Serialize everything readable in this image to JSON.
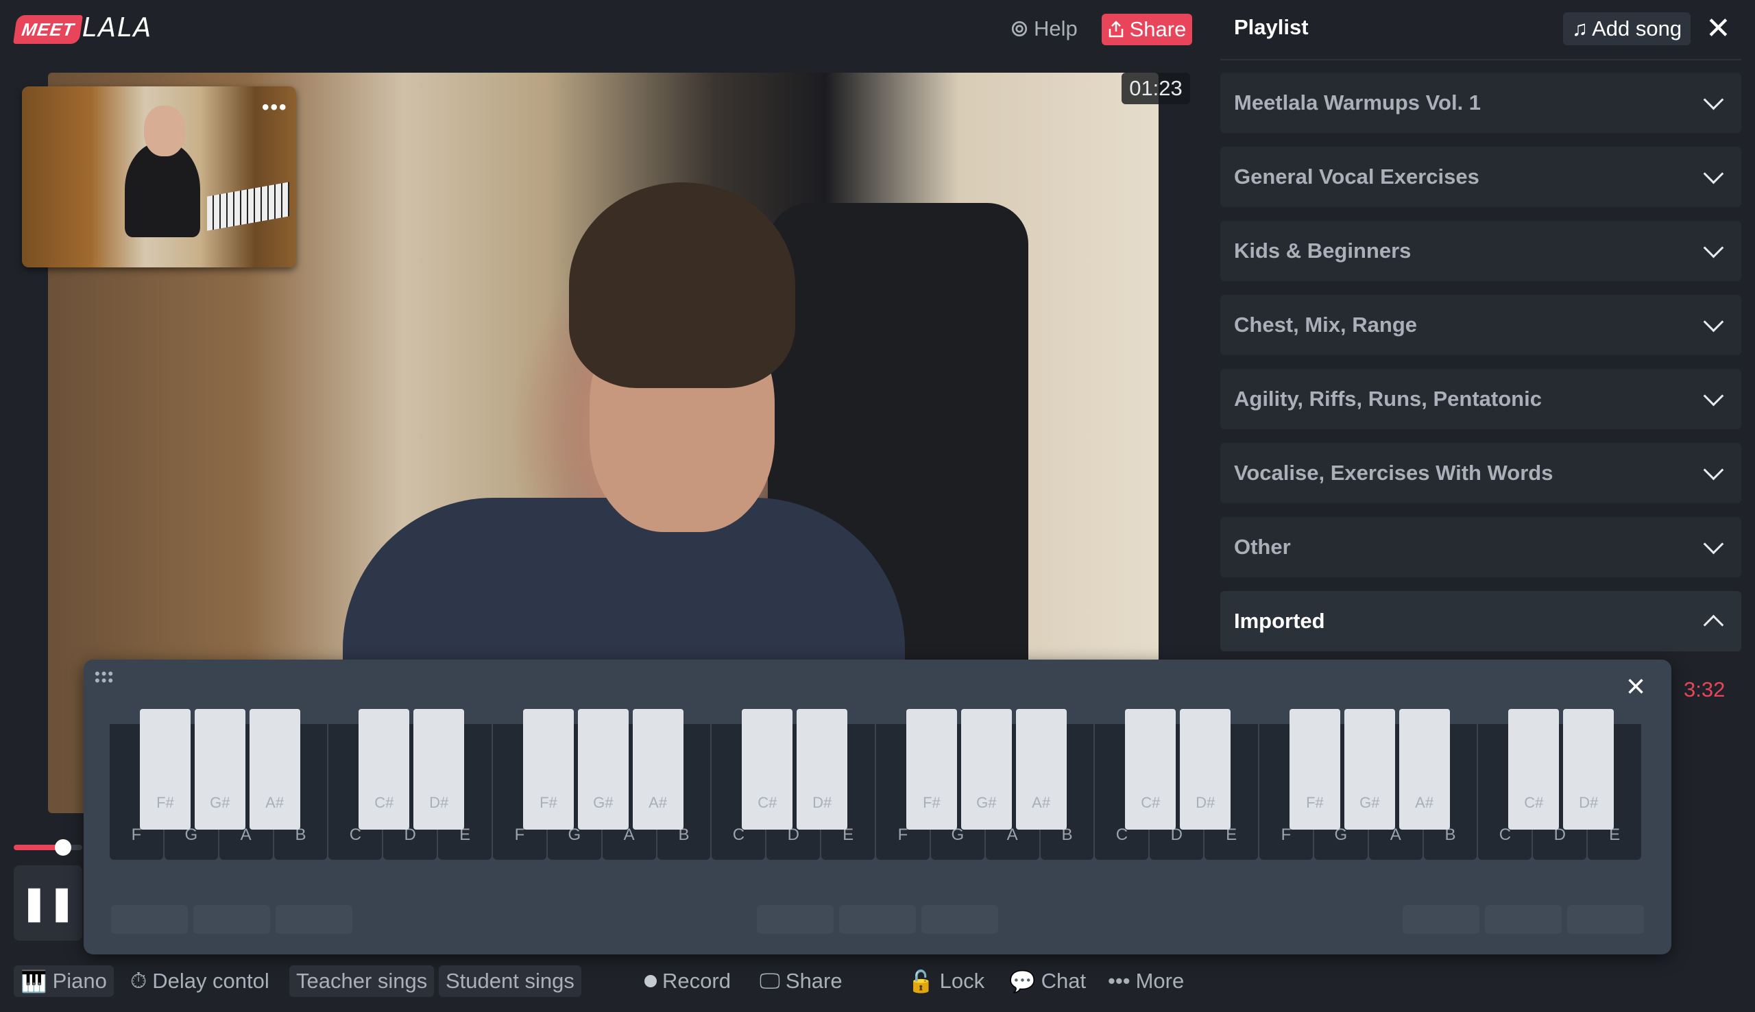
{
  "header": {
    "logo_badge": "MEET",
    "logo_text": "LALA",
    "help_label": "Help",
    "share_label": "Share"
  },
  "video": {
    "timer": "01:23",
    "pip_more": "•••"
  },
  "piano": {
    "white_keys": [
      "F",
      "G",
      "A",
      "B",
      "C",
      "D",
      "E",
      "F",
      "G",
      "A",
      "B",
      "C",
      "D",
      "E",
      "F",
      "G",
      "A",
      "B",
      "C",
      "D",
      "E",
      "F",
      "G",
      "A",
      "B",
      "C",
      "D",
      "E"
    ],
    "black_keys": [
      "F#",
      "G#",
      "A#",
      "C#",
      "D#",
      "F#",
      "G#",
      "A#",
      "C#",
      "D#",
      "F#",
      "G#",
      "A#",
      "C#",
      "D#",
      "F#",
      "G#",
      "A#",
      "C#",
      "D#"
    ],
    "close_icon": "×"
  },
  "playlist": {
    "title": "Playlist",
    "add_song_label": "Add song",
    "items": [
      {
        "label": "Meetlala Warmups Vol. 1"
      },
      {
        "label": "General Vocal Exercises"
      },
      {
        "label": "Kids & Beginners"
      },
      {
        "label": "Chest, Mix, Range"
      },
      {
        "label": "Agility, Riffs, Runs, Pentatonic"
      },
      {
        "label": "Vocalise, Exercises With Words"
      },
      {
        "label": "Other"
      },
      {
        "label": "Imported"
      }
    ],
    "track_time": "3:32"
  },
  "toolbar": {
    "piano": "Piano",
    "delay": "Delay contol",
    "teacher": "Teacher sings",
    "student": "Student sings",
    "record": "Record",
    "share": "Share",
    "lock": "Lock",
    "chat": "Chat",
    "more": "More"
  },
  "colors": {
    "accent": "#e8455a",
    "background": "#1f2329",
    "panel": "#3a4350"
  }
}
